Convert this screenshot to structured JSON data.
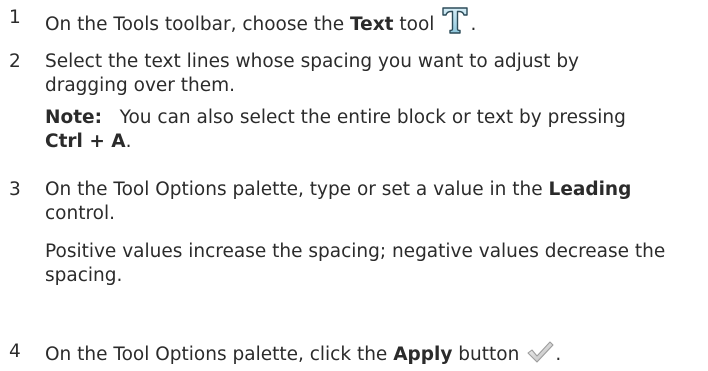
{
  "steps": [
    {
      "number": "1",
      "lines": [
        {
          "pre": "On the Tools toolbar, choose the ",
          "bold": "Text",
          "post": " tool",
          "after_icon": "."
        }
      ],
      "icon": "text-tool-icon"
    },
    {
      "number": "2",
      "lines": [
        "Select the text lines whose spacing you want to adjust by",
        "dragging over them."
      ],
      "note": {
        "label": "Note:",
        "text_line1": "You can also select the entire block or text by pressing",
        "shortcut": "Ctrl + A",
        "end": "."
      }
    },
    {
      "number": "3",
      "line1_pre": "On the Tool Options palette, type or set a value in the ",
      "line1_bold": "Leading",
      "line2": "control.",
      "para_line1": "Positive values increase the spacing; negative values decrease the",
      "para_line2": "spacing."
    },
    {
      "number": "4",
      "pre": "On the Tool Options palette, click the ",
      "bold": "Apply",
      "post": " button",
      "after_icon": ".",
      "icon": "apply-checkmark-icon"
    }
  ]
}
